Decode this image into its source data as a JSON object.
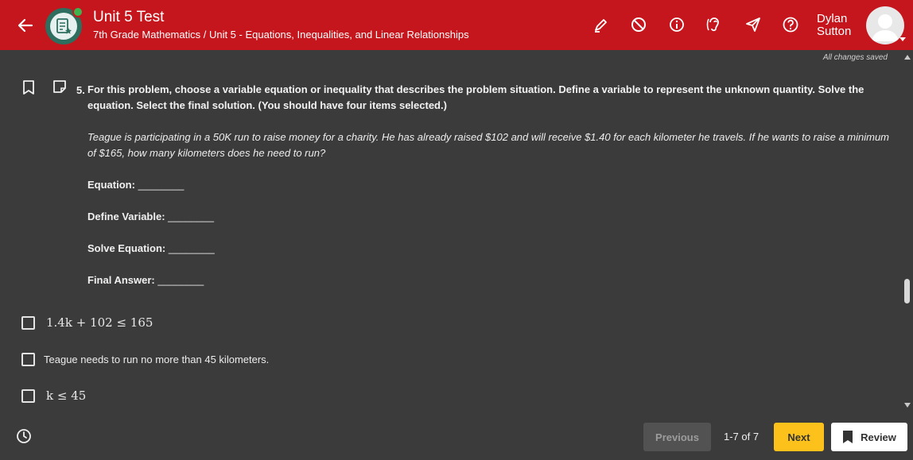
{
  "header": {
    "title": "Unit 5 Test",
    "breadcrumb": "7th Grade Mathematics / Unit 5 - Equations, Inequalities, and Linear Relationships",
    "user_name": "Dylan Sutton",
    "tools": [
      "highlighter-icon",
      "eliminate-icon",
      "info-icon",
      "text-to-speech-icon",
      "send-icon",
      "help-icon"
    ]
  },
  "status": {
    "saved": "All changes saved"
  },
  "question": {
    "number": "5.",
    "prompt": "For this problem, choose a variable equation or inequality that describes the problem situation. Define a variable to represent the unknown quantity. Solve the equation. Select the final solution. (You should have four items selected.)",
    "scenario": "Teague is participating in a 50K run to raise money for a charity. He has already raised $102 and will receive $1.40 for each kilometer he travels. If he wants to raise a minimum of $165, how many kilometers does he need to run?",
    "fields": [
      {
        "label": "Equation:",
        "blank": "________"
      },
      {
        "label": "Define Variable:",
        "blank": "________"
      },
      {
        "label": "Solve Equation:",
        "blank": "________"
      },
      {
        "label": "Final Answer:",
        "blank": "________"
      }
    ],
    "options": [
      {
        "text": "1.4k + 102 ≤ 165",
        "checked": false
      },
      {
        "text": "Teague needs to run no more than 45 kilometers.",
        "checked": false
      },
      {
        "text": "k ≤ 45",
        "checked": false
      }
    ]
  },
  "footer": {
    "previous": "Previous",
    "page_count": "1-7 of 7",
    "next": "Next",
    "review": "Review"
  },
  "colors": {
    "header": "#c4161c",
    "next_button": "#fcc21b",
    "background": "#3b3b3b"
  }
}
